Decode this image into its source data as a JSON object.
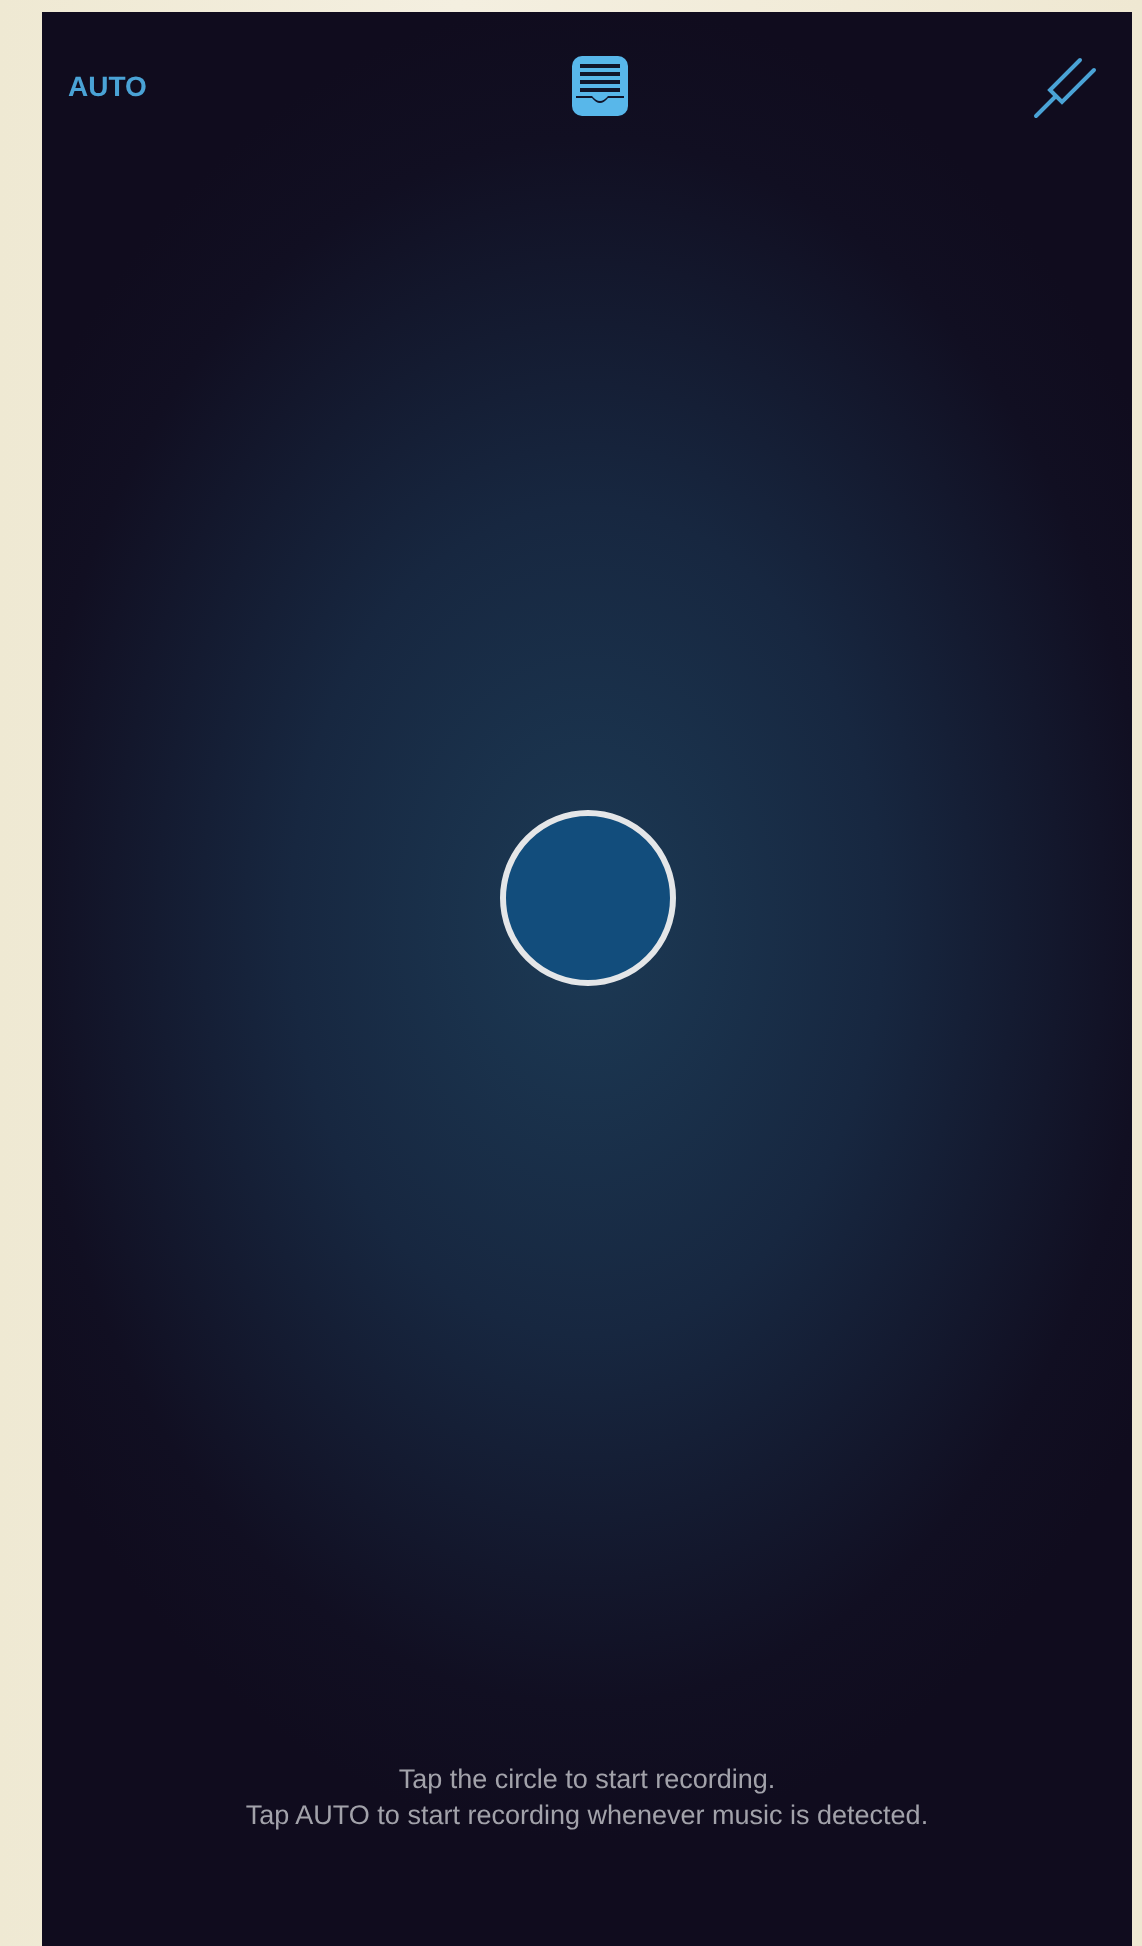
{
  "top_bar": {
    "auto_button": "AUTO"
  },
  "hint_lines": [
    "Tap the circle to start recording.",
    "Tap AUTO to start recording whenever music is detected."
  ]
}
